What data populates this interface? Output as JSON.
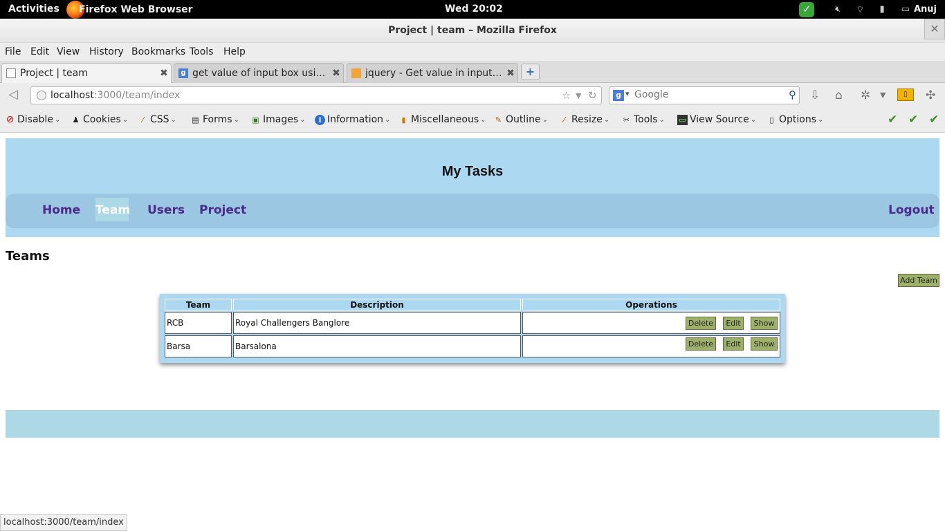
{
  "os": {
    "activities": "Activities",
    "app_name": "Firefox Web Browser",
    "clock": "Wed 20:02",
    "user": "Anuj"
  },
  "window": {
    "title": "Project | team – Mozilla Firefox",
    "close_glyph": "✕"
  },
  "menu": [
    "File",
    "Edit",
    "View",
    "History",
    "Bookmarks",
    "Tools",
    "Help"
  ],
  "tabs": [
    {
      "label": "Project | team"
    },
    {
      "label": "get value of input box using j..."
    },
    {
      "label": "jquery - Get value in input te..."
    }
  ],
  "tab_close": "✖",
  "newtab_glyph": "+",
  "address": {
    "host": "localhost",
    "path": ":3000/team/index"
  },
  "search": {
    "placeholder": "Google"
  },
  "webdev": [
    "Disable",
    "Cookies",
    "CSS",
    "Forms",
    "Images",
    "Information",
    "Miscellaneous",
    "Outline",
    "Resize",
    "Tools",
    "View Source",
    "Options"
  ],
  "site": {
    "heading": "My Tasks",
    "nav": [
      "Home",
      "Team",
      "Users",
      "Project"
    ],
    "logout": "Logout",
    "page_title": "Teams",
    "add_button": "Add Team",
    "table": {
      "headers": [
        "Team",
        "Description",
        "Operations"
      ],
      "rows": [
        {
          "team": "RCB",
          "description": "Royal Challengers Banglore"
        },
        {
          "team": "Barsa",
          "description": "Barsalona"
        }
      ],
      "actions": [
        "Delete",
        "Edit",
        "Show"
      ]
    }
  },
  "status_url": "localhost:3000/team/index",
  "colors": {
    "header_bg": "#ADD8F2",
    "nav_bg": "#9cc7e2",
    "nav_link": "#4b2a8c",
    "button_bg": "#9db06a",
    "footer_bg": "#ADD8E6"
  }
}
